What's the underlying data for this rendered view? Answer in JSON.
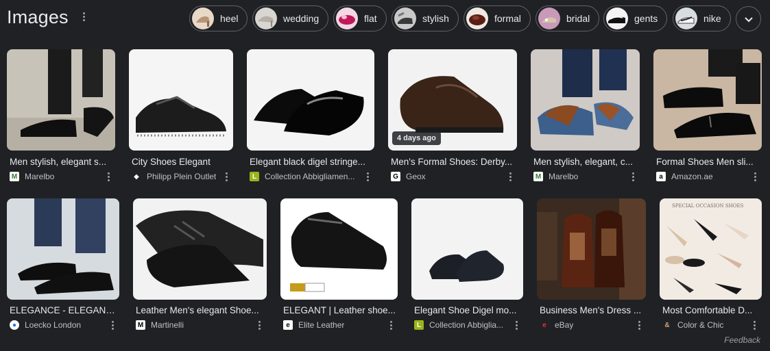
{
  "header": {
    "title": "Images"
  },
  "chips": [
    {
      "label": "heel"
    },
    {
      "label": "wedding"
    },
    {
      "label": "flat"
    },
    {
      "label": "stylish"
    },
    {
      "label": "formal"
    },
    {
      "label": "bridal"
    },
    {
      "label": "gents"
    },
    {
      "label": "nike"
    }
  ],
  "results": [
    {
      "caption": "Men stylish, elegant s...",
      "source": "Marelbo"
    },
    {
      "caption": "City Shoes Elegant",
      "source": "Philipp Plein Outlet"
    },
    {
      "caption": "Elegant black digel stringe...",
      "source": "Collection Abbigliamen..."
    },
    {
      "caption": "Men's Formal Shoes: Derby...",
      "source": "Geox",
      "badge": "4 days ago"
    },
    {
      "caption": "Men stylish, elegant, c...",
      "source": "Marelbo"
    },
    {
      "caption": "Formal Shoes Men sli...",
      "source": "Amazon.ae"
    },
    {
      "caption": "ELEGANCE - ELEGANT...",
      "source": "Loecko London"
    },
    {
      "caption": "Leather Men's elegant Shoe...",
      "source": "Martinelli"
    },
    {
      "caption": "ELEGANT | Leather shoe...",
      "source": "Elite Leather"
    },
    {
      "caption": "Elegant Shoe Digel mo...",
      "source": "Collection Abbiglia..."
    },
    {
      "caption": "Business Men's Dress ...",
      "source": "eBay"
    },
    {
      "caption": "Most Comfortable D...",
      "source": "Color & Chic",
      "image_text": "SPECIAL OCCASION SHOES"
    }
  ],
  "footer": {
    "feedback": "Feedback"
  },
  "colors": {
    "background": "#202124",
    "text": "#e8eaed",
    "subtle": "#bdc1c6",
    "border": "#5f6368"
  }
}
